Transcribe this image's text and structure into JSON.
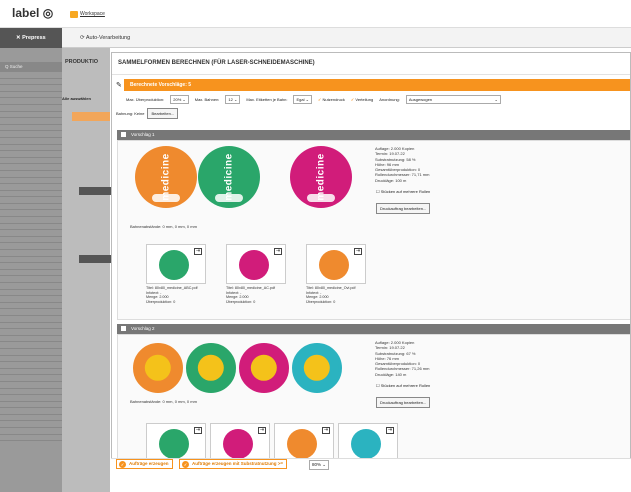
{
  "app": {
    "logo": "label",
    "workspace": "Workspace",
    "tab_prepress": "Prepress",
    "tab_auto": "Auto-Verarbeitung",
    "produktion": "PRODUKTIO",
    "search": "Q Suche",
    "unbear": "Unbear",
    "alle": "Alle auswählen"
  },
  "dialog": {
    "title": "SAMMELFORMEN BERECHNEN (FÜR LASER-SCHNEIDEMASCHINE)",
    "orange": "Berechnete Vorschläge: 5",
    "opt": {
      "ueber_label": "Max. Überproduktion:",
      "ueber_val": "20%",
      "bahnen_label": "Max. Bahnen:",
      "bahnen_val": "12",
      "etiketten_label": "Max. Etiketten je Bahn:",
      "etiketten_val": "Egal",
      "nutzendruck": "Nutzendruck",
      "verteilung": "Verteilung",
      "anordnung_label": "Anordnung:",
      "anordnung_val": "Ausgewogen"
    },
    "bahnung": "Bahnung: Keine",
    "bearbeiten": "Bearbeiten...",
    "v1": {
      "title": "Vorschlag 1",
      "info": [
        "Auflage: 2.000 Kopien",
        "Termin: 19.07.22",
        "Substratnutzung: 58 %",
        "Höhe: 96 mm",
        "Gesamtüberproduktion: 0",
        "Rollendurchmesser: 71,71 mm",
        "Druckläge: 100 m"
      ],
      "stuecken": "Stücken auf mehrere Rollen",
      "druck": "Druckauftrag bearbeiten...",
      "bahnen": "Bahnenabstände: 0 mm, 0 mm, 0 mm",
      "label_text": "medicine",
      "items": [
        {
          "titel": "Titel: 80x80_medicine_ABC.pdf",
          "info": "Infotext: -",
          "menge": "Menge: 2.000",
          "ueber": "Überproduktion: 0"
        },
        {
          "titel": "Titel: 80x80_medicine_AC.pdf",
          "info": "Infotext: -",
          "menge": "Menge: 2.000",
          "ueber": "Überproduktion: 0"
        },
        {
          "titel": "Titel: 80x80_medicine_Ovi.pdf",
          "info": "Infotext: -",
          "menge": "Menge: 2.000",
          "ueber": "Überproduktion: 0"
        }
      ]
    },
    "v2": {
      "title": "Vorschlag 2",
      "info": [
        "Auflage: 2.000 Kopien",
        "Termin: 19.07.22",
        "Substratnutzung: 67 %",
        "Höhe: 76 mm",
        "Gesamtüberproduktion: 0",
        "Rollendurchmesser: 71,26 mm",
        "Druckläge: 140 m"
      ],
      "stuecken": "Stücken auf mehrere Rollen",
      "druck": "Druckauftrag bearbeiten...",
      "bahnen": "Bahnenabstände: 0 mm, 0 mm, 0 mm"
    }
  },
  "footer": {
    "b1": "Aufträge erzeugen",
    "b2": "Aufträge erzeugen mit Substratnutzung >=",
    "pct": "80%"
  },
  "colors": {
    "orange": "#f7931e",
    "green": "#2aa66a",
    "magenta": "#d11c7a",
    "ora": "#ef8a2e",
    "teal": "#2bb3c0"
  }
}
